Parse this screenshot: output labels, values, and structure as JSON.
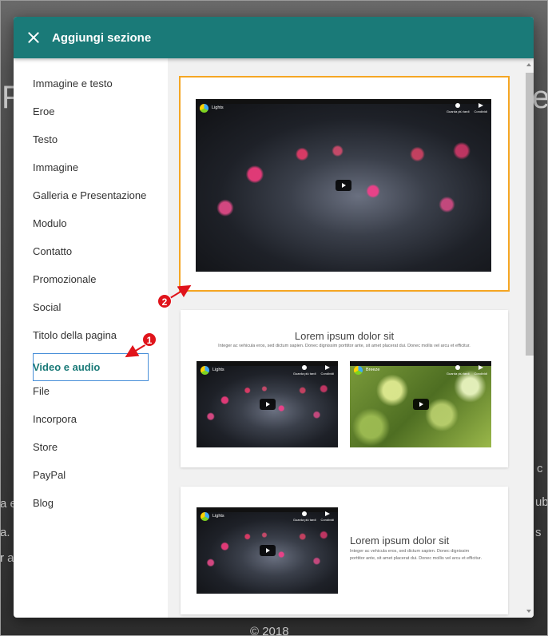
{
  "modal": {
    "title": "Aggiungi sezione",
    "close_icon": "close-icon"
  },
  "sidebar": {
    "items": [
      {
        "label": "Immagine e testo"
      },
      {
        "label": "Eroe"
      },
      {
        "label": "Testo"
      },
      {
        "label": "Immagine"
      },
      {
        "label": "Galleria e Presentazione"
      },
      {
        "label": "Modulo"
      },
      {
        "label": "Contatto"
      },
      {
        "label": "Promozionale"
      },
      {
        "label": "Social"
      },
      {
        "label": "Titolo della pagina"
      },
      {
        "label": "Video e audio"
      },
      {
        "label": "File"
      },
      {
        "label": "Incorpora"
      },
      {
        "label": "Store"
      },
      {
        "label": "PayPal"
      },
      {
        "label": "Blog"
      }
    ],
    "active_index": 10
  },
  "cards": {
    "card1": {
      "video": {
        "name": "Lights",
        "watch_later": "Guarda più tardi",
        "share": "Condividi"
      }
    },
    "card2": {
      "title": "Lorem ipsum dolor sit",
      "subtitle": "Integer ac vehicula eros, sed dictum sapien. Donec dignissim porttitor ante, sit amet placerat dui. Donec mollis vel arcu et efficitur.",
      "video_left": {
        "name": "Lights",
        "watch_later": "Guarda più tardi",
        "share": "Condividi"
      },
      "video_right": {
        "name": "Breeze",
        "watch_later": "Guarda più tardi",
        "share": "Condividi"
      }
    },
    "card3": {
      "title": "Lorem ipsum dolor sit",
      "subtitle_line1": "Integer ac vehicula eros, sed dictum sapien. Donec dignissim",
      "subtitle_line2": "porttitor ante, sit amet placerat dui. Donec mollis vel arcu et efficitur.",
      "video": {
        "name": "Lights",
        "watch_later": "Guarda più tardi",
        "share": "Condividi"
      }
    }
  },
  "annotations": {
    "badge1": "1",
    "badge2": "2"
  },
  "background": {
    "footer": "© 2018"
  },
  "colors": {
    "header": "#1a7a78",
    "selected_outline": "#f5a623",
    "badge": "#e0141b",
    "active_text": "#1a7a78"
  }
}
